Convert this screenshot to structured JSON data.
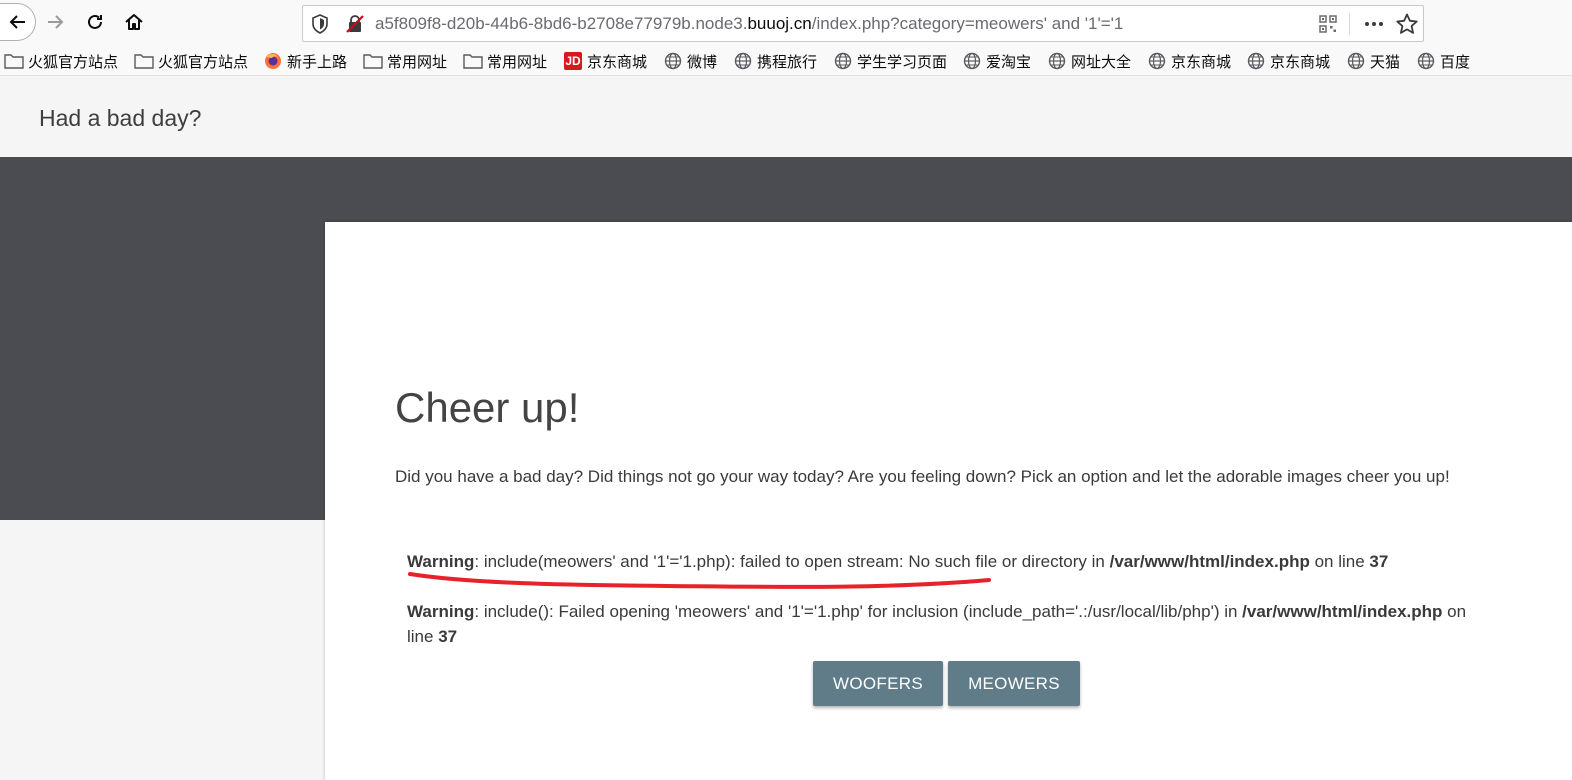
{
  "browser": {
    "url_prefix": "a5f809f8-d20b-44b6-8bd6-b2708e77979b.node3.",
    "url_domain": "buuoj.cn",
    "url_suffix": "/index.php?category=meowers' and '1'='1"
  },
  "bookmarks": [
    {
      "label": "火狐官方站点",
      "icon": "folder-icon"
    },
    {
      "label": "火狐官方站点",
      "icon": "folder-icon"
    },
    {
      "label": "新手上路",
      "icon": "firefox-icon"
    },
    {
      "label": "常用网址",
      "icon": "folder-icon"
    },
    {
      "label": "常用网址",
      "icon": "folder-icon"
    },
    {
      "label": "京东商城",
      "icon": "jd-icon",
      "icon_text": "JD"
    },
    {
      "label": "微博",
      "icon": "globe-icon"
    },
    {
      "label": "携程旅行",
      "icon": "globe-icon"
    },
    {
      "label": "学生学习页面",
      "icon": "globe-icon"
    },
    {
      "label": "爱淘宝",
      "icon": "globe-icon"
    },
    {
      "label": "网址大全",
      "icon": "globe-icon"
    },
    {
      "label": "京东商城",
      "icon": "globe-icon"
    },
    {
      "label": "京东商城",
      "icon": "globe-icon"
    },
    {
      "label": "天猫",
      "icon": "globe-icon"
    },
    {
      "label": "百度",
      "icon": "globe-icon"
    }
  ],
  "page": {
    "site_title": "Had a bad day?",
    "card_title": "Cheer up!",
    "intro": "Did you have a bad day? Did things not go your way today? Are you feeling down? Pick an option and let the adorable images cheer you up!",
    "warning1": {
      "label": "Warning",
      "message": ": include(meowers' and '1'='1.php): failed to open stream: No such file or directory in ",
      "path": "/var/www/html/index.php",
      "on_line": " on line ",
      "line": "37"
    },
    "warning2": {
      "label": "Warning",
      "message": ": include(): Failed opening 'meowers' and '1'='1.php' for inclusion (include_path='.:/usr/local/lib/php') in ",
      "path": "/var/www/html/index.php",
      "on_line": " on line ",
      "line": "37"
    },
    "buttons": {
      "woofers": "WOOFERS",
      "meowers": "MEOWERS"
    }
  },
  "colors": {
    "hero": "#4a4c51",
    "button": "#5f7c88",
    "annotation": "#e8222a"
  }
}
